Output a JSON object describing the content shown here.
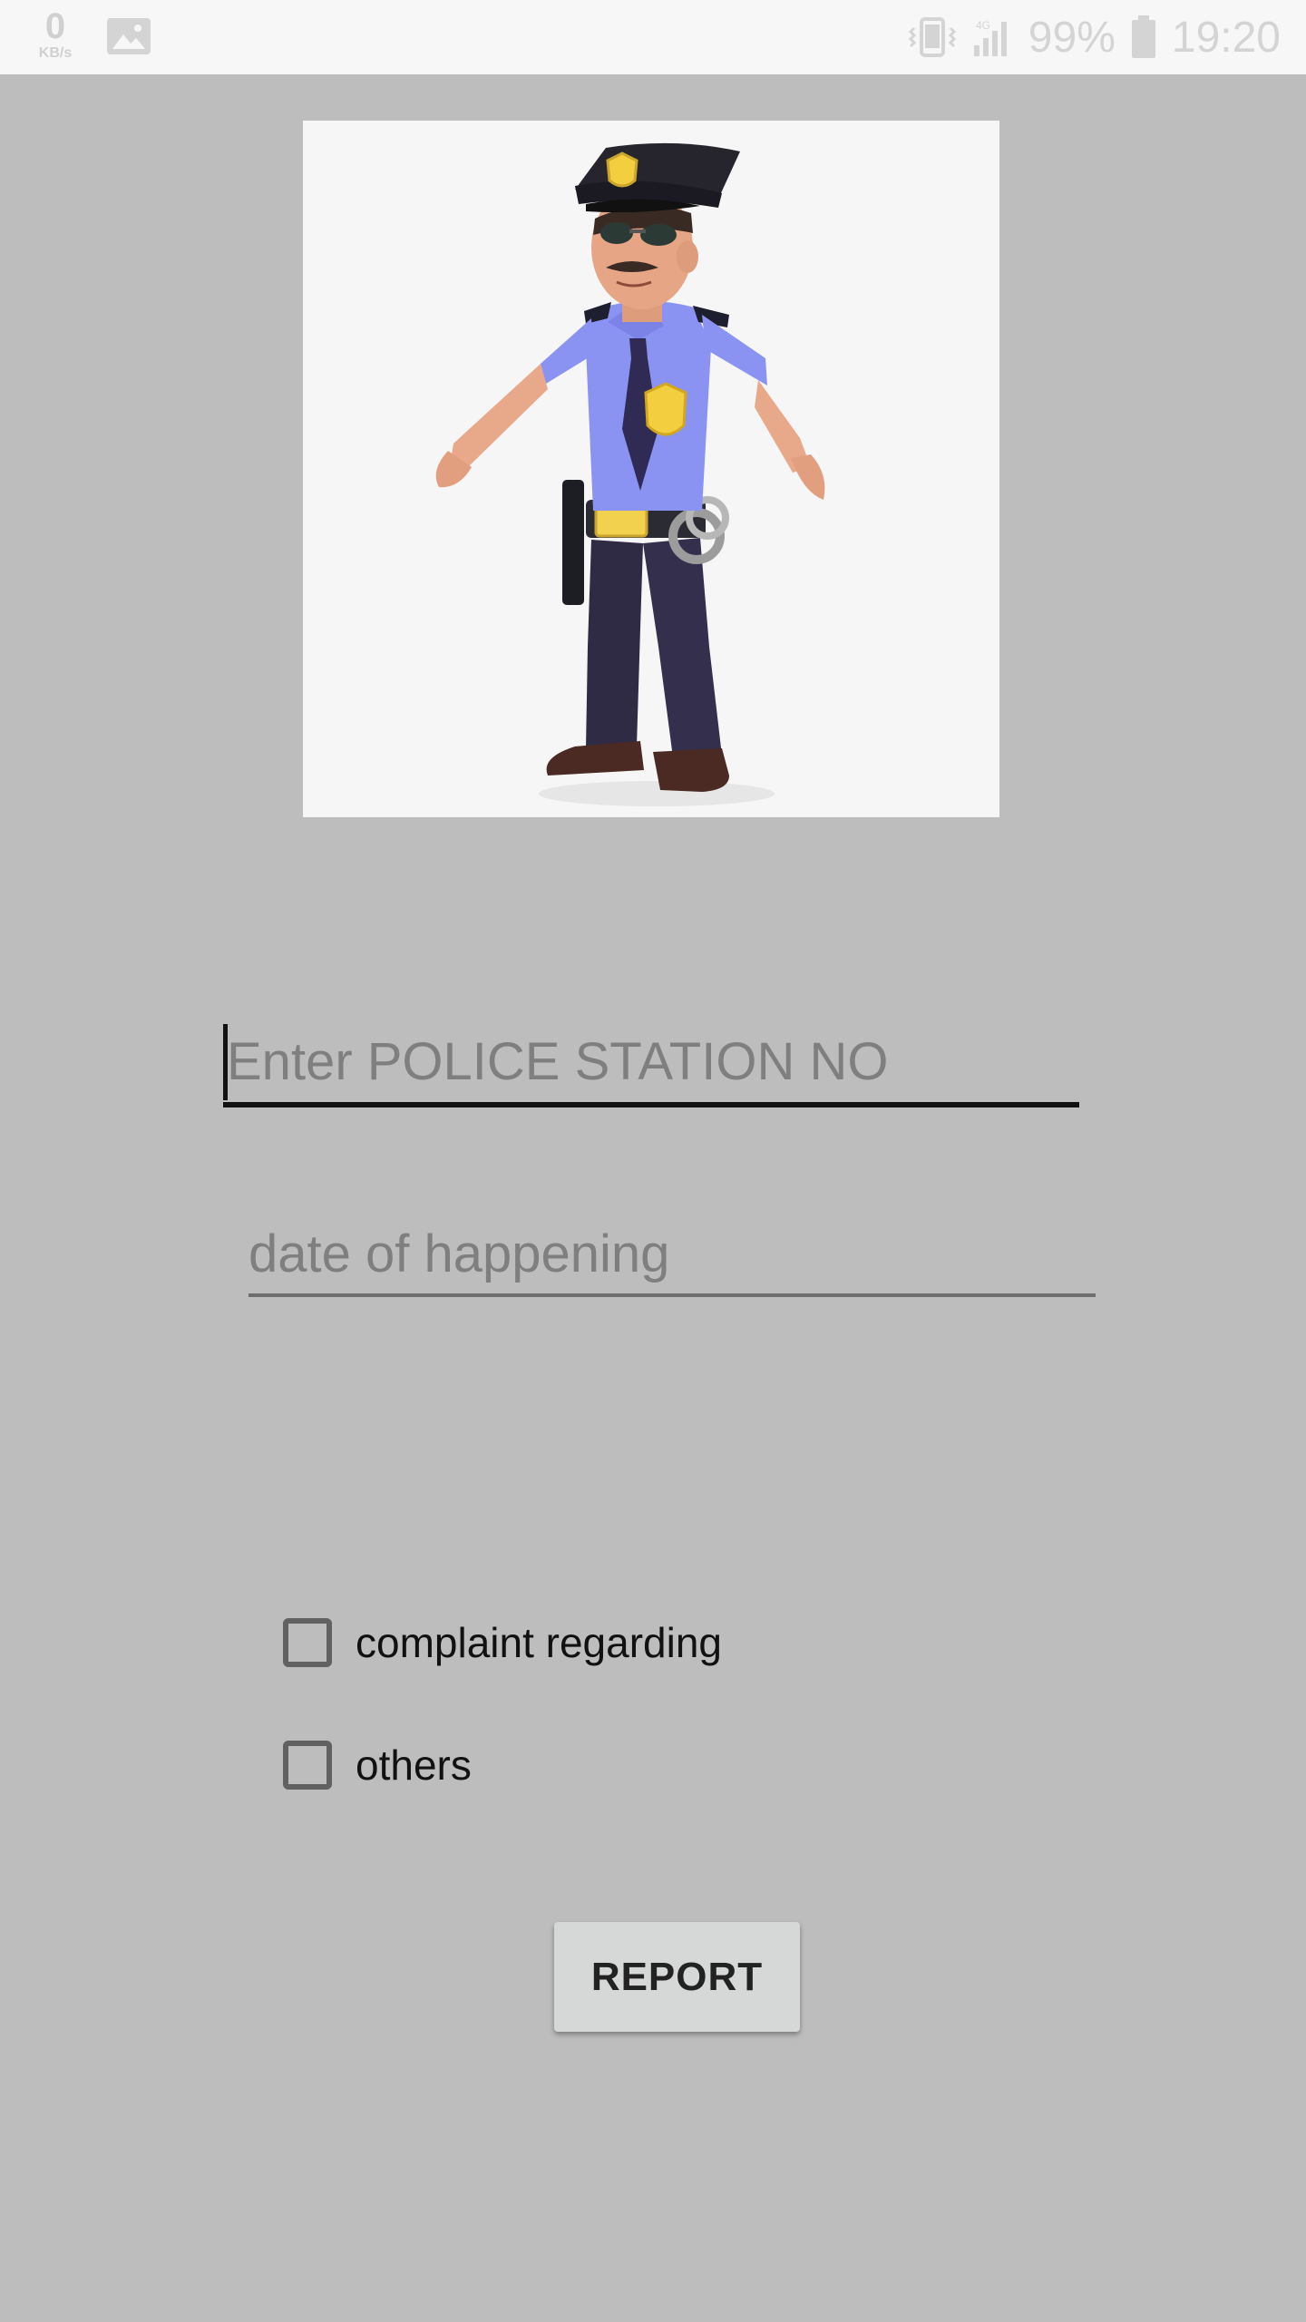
{
  "status_bar": {
    "net_speed_value": "0",
    "net_speed_unit": "KB/s",
    "battery_text": "99%",
    "time": "19:20",
    "left_icons": [
      "net-speed-indicator",
      "image-notification-icon"
    ],
    "right_icons": [
      "vibrate-icon",
      "signal-icon",
      "battery-icon"
    ]
  },
  "main": {
    "image_subject": "police-officer-cartoon",
    "station_input": {
      "value": "",
      "placeholder": "Enter POLICE STATION NO"
    },
    "date_input": {
      "value": "",
      "placeholder": "date of happening"
    },
    "checkboxes": [
      {
        "label": "complaint regarding",
        "checked": false
      },
      {
        "label": "others",
        "checked": false
      }
    ],
    "report_button_label": "REPORT"
  },
  "colors": {
    "background": "#bdbdbd",
    "status_bar": "#f7f7f7",
    "button": "#d6d7d7",
    "accent_underline": "#111111"
  }
}
